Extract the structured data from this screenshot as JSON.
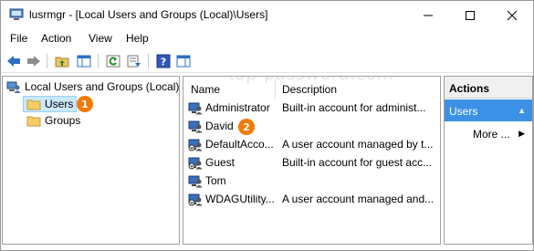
{
  "window": {
    "title": "lusrmgr - [Local Users and Groups (Local)\\Users]"
  },
  "menu": [
    "File",
    "Action",
    "View",
    "Help"
  ],
  "toolbar": {
    "buttons": [
      "back-arrow-icon",
      "forward-arrow-icon",
      "up-folder-icon",
      "show-hide-tree-icon",
      "refresh-icon",
      "export-list-icon",
      "help-icon",
      "action-pane-icon"
    ]
  },
  "tree": {
    "root": "Local Users and Groups (Local)",
    "children": [
      "Users",
      "Groups"
    ],
    "selected": "Users"
  },
  "badges": [
    "1",
    "2"
  ],
  "list": {
    "columns": [
      "Name",
      "Description"
    ],
    "rows": [
      {
        "name": "Administrator",
        "description": "Built-in account for administ..."
      },
      {
        "name": "David",
        "description": ""
      },
      {
        "name": "DefaultAcco...",
        "description": "A user account managed by t..."
      },
      {
        "name": "Guest",
        "description": "Built-in account for guest acc..."
      },
      {
        "name": "Tom",
        "description": ""
      },
      {
        "name": "WDAGUtility...",
        "description": "A user account managed and..."
      }
    ]
  },
  "watermark": "top-password.com",
  "actions": {
    "header": "Actions",
    "section": "Users",
    "more": "More ..."
  },
  "colors": {
    "selection": "#cce8ff",
    "actions_selected": "#3c91e6",
    "badge": "#f37b05"
  }
}
